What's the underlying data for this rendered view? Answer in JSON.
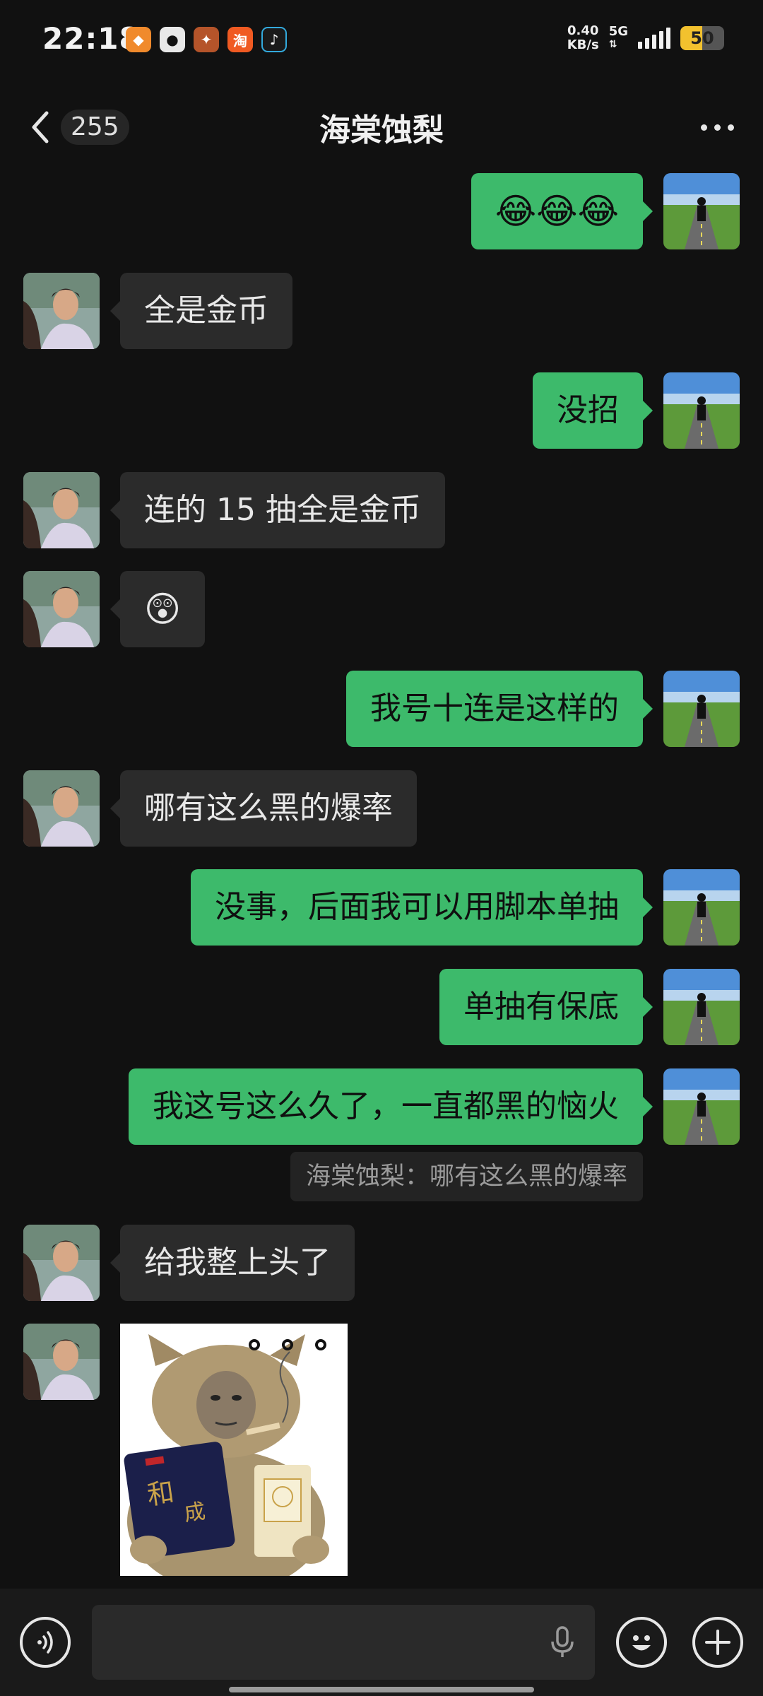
{
  "status_bar": {
    "time": "22:18",
    "apps": [
      {
        "icon": "orange-app-icon",
        "glyph": "◆",
        "color": "#f08a2c"
      },
      {
        "icon": "qq-penguin-icon",
        "glyph": "●",
        "color": "#e8e8e8"
      },
      {
        "icon": "game-hero-icon",
        "glyph": "✦",
        "color": "#b5542a"
      },
      {
        "icon": "taobao-icon",
        "glyph": "淘",
        "color": "#f05a22"
      },
      {
        "icon": "tiktok-icon",
        "glyph": "♪",
        "color": "#1a1a1a"
      }
    ],
    "net_speed_value": "0.40",
    "net_speed_unit": "KB/s",
    "network_type": "5G",
    "battery_level": "50",
    "battery_color": "#f2c12e"
  },
  "header": {
    "unread_count": "255",
    "title": "海棠蚀梨"
  },
  "colors": {
    "sent_bubble": "#3dba6b",
    "received_bubble": "#2b2b2b"
  },
  "messages": [
    {
      "side": "right",
      "text": "😂😂😂",
      "is_emoji": true
    },
    {
      "side": "left",
      "text": "全是金币"
    },
    {
      "side": "right",
      "text": "没招"
    },
    {
      "side": "left",
      "text": "连的 15 抽全是金币"
    },
    {
      "side": "left",
      "text": "😲",
      "is_emoji": true
    },
    {
      "side": "right",
      "text": "我号十连是这样的"
    },
    {
      "side": "left",
      "text": "哪有这么黑的爆率"
    },
    {
      "side": "right",
      "text": "没事，后面我可以用脚本单抽"
    },
    {
      "side": "right",
      "text": "单抽有保底"
    },
    {
      "side": "right",
      "text": "我这号这么久了，一直都黑的恼火"
    },
    {
      "side": "left",
      "text": "给我整上头了"
    }
  ],
  "quote_reply": "海棠蚀梨：哪有这么黑的爆率",
  "sticker": {
    "kind": "cat-meme-sticker",
    "dots": "。。。"
  },
  "input_bar": {
    "voice_icon": "voice-icon",
    "emoji_icon": "emoji-icon",
    "plus_icon": "plus-icon",
    "mic_icon": "mic-icon"
  }
}
